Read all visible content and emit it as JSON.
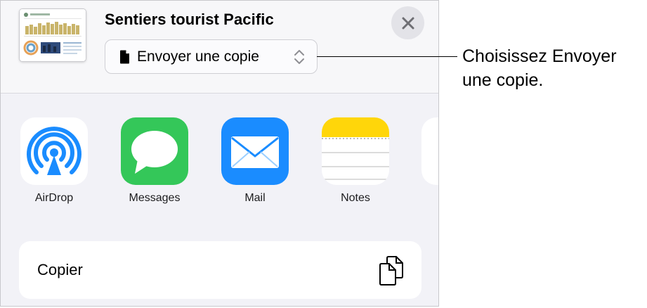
{
  "sheet": {
    "title": "Sentiers tourist Pacific",
    "format_select": {
      "value": "Envoyer une copie"
    },
    "apps": [
      {
        "name": "AirDrop",
        "icon": "airdrop-icon"
      },
      {
        "name": "Messages",
        "icon": "messages-icon",
        "color": "#34c759"
      },
      {
        "name": "Mail",
        "icon": "mail-icon",
        "color": "#1a8cff"
      },
      {
        "name": "Notes",
        "icon": "notes-icon",
        "color": "#ffd60a"
      }
    ],
    "actions": [
      {
        "label": "Copier",
        "icon": "copy-icon"
      }
    ]
  },
  "callout": {
    "text": "Choisissez Envoyer une copie."
  }
}
